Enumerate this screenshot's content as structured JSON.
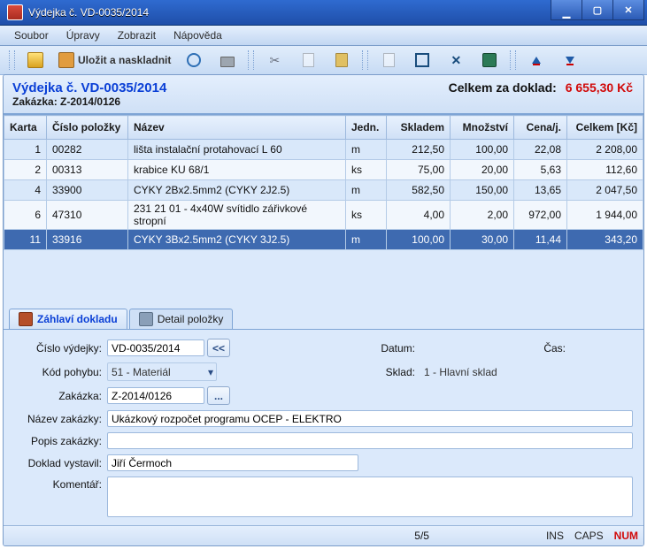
{
  "window": {
    "title": "Výdejka č. VD-0035/2014"
  },
  "menu": {
    "soubor": "Soubor",
    "upravy": "Úpravy",
    "zobrazit": "Zobrazit",
    "napoveda": "Nápověda"
  },
  "toolbar": {
    "save_stock": "Uložit a naskladnit"
  },
  "header": {
    "doc_title": "Výdejka č. VD-0035/2014",
    "order_label": "Zakázka:",
    "order_no": "Z-2014/0126",
    "total_label": "Celkem za doklad:",
    "total_value": "6 655,30 Kč"
  },
  "columns": {
    "karta": "Karta",
    "cislo": "Číslo položky",
    "nazev": "Název",
    "jedn": "Jedn.",
    "skladem": "Skladem",
    "mnozstvi": "Množství",
    "cena": "Cena/j.",
    "celkem": "Celkem [Kč]"
  },
  "rows": [
    {
      "karta": "1",
      "cislo": "00282",
      "nazev": "lišta instalační protahovací L 60",
      "jedn": "m",
      "skl": "212,50",
      "mn": "100,00",
      "cena": "22,08",
      "cel": "2 208,00"
    },
    {
      "karta": "2",
      "cislo": "00313",
      "nazev": "krabice KU 68/1",
      "jedn": "ks",
      "skl": "75,00",
      "mn": "20,00",
      "cena": "5,63",
      "cel": "112,60"
    },
    {
      "karta": "4",
      "cislo": "33900",
      "nazev": "CYKY 2Bx2.5mm2 (CYKY 2J2.5)",
      "jedn": "m",
      "skl": "582,50",
      "mn": "150,00",
      "cena": "13,65",
      "cel": "2 047,50"
    },
    {
      "karta": "6",
      "cislo": "47310",
      "nazev": "231 21 01 - 4x40W svítidlo zářivkové stropní",
      "jedn": "ks",
      "skl": "4,00",
      "mn": "2,00",
      "cena": "972,00",
      "cel": "1 944,00"
    },
    {
      "karta": "11",
      "cislo": "33916",
      "nazev": "CYKY 3Bx2.5mm2 (CYKY 3J2.5)",
      "jedn": "m",
      "skl": "100,00",
      "mn": "30,00",
      "cena": "11,44",
      "cel": "343,20"
    }
  ],
  "tabs": {
    "header": "Záhlaví dokladu",
    "detail": "Detail položky"
  },
  "form": {
    "cislo_vyd_label": "Číslo výdejky:",
    "cislo_vyd": "VD-0035/2014",
    "prev": "<<",
    "datum_label": "Datum:",
    "datum": "",
    "cas_label": "Čas:",
    "cas": "",
    "kod_pohybu_label": "Kód pohybu:",
    "kod_pohybu": "51 - Materiál",
    "sklad_label": "Sklad:",
    "sklad": "1 - Hlavní sklad",
    "zakazka_label": "Zakázka:",
    "zakazka": "Z-2014/0126",
    "browse": "...",
    "nazev_zak_label": "Název zakázky:",
    "nazev_zak": "Ukázkový rozpočet programu OCEP - ELEKTRO",
    "popis_zak_label": "Popis zakázky:",
    "popis_zak": "",
    "vystavil_label": "Doklad vystavil:",
    "vystavil": "Jiří Čermoch",
    "koment_label": "Komentář:",
    "koment": ""
  },
  "status": {
    "counter": "5/5",
    "ins": "INS",
    "caps": "CAPS",
    "num": "NUM"
  }
}
